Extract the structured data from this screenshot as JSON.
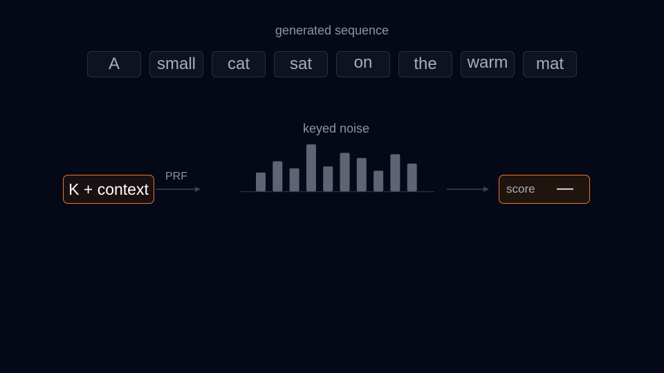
{
  "sequence": {
    "title": "generated sequence",
    "tokens": [
      "A",
      "small",
      "cat",
      "sat",
      "on",
      "the",
      "warm",
      "mat"
    ]
  },
  "pipeline": {
    "input_label": "K + context",
    "arrow_label": "PRF",
    "noise_title": "keyed noise",
    "noise_levels": [
      0.4,
      0.64,
      0.49,
      1.0,
      0.53,
      0.82,
      0.71,
      0.44,
      0.79,
      0.59
    ],
    "output_label": "score",
    "output_value": "—"
  },
  "colors": {
    "background": "#050816",
    "accent": "#e87a2e",
    "bar": "#5f6373",
    "arrow": "#3c4250"
  }
}
